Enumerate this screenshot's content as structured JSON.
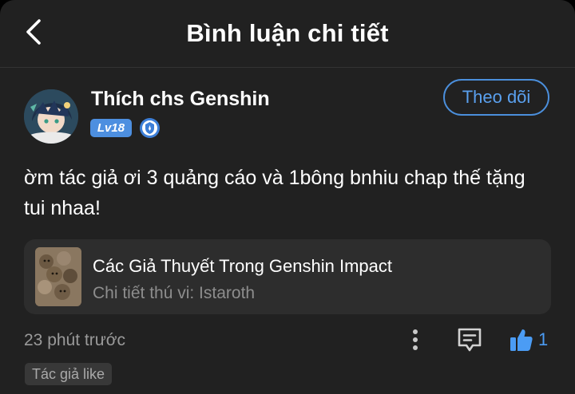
{
  "header": {
    "title": "Bình luận chi tiết",
    "back_icon": "chevron-left-icon"
  },
  "comment": {
    "username": "Thích chs Genshin",
    "level": "Lv18",
    "verified_icon": "shield-badge-icon",
    "follow_label": "Theo dõi",
    "text": "ờm tác giả ơi 3 quảng cáo và 1bông bnhiu chap thế tặng tui nhaa!",
    "timestamp": "23 phút trước",
    "like_count": "1",
    "author_like_tag": "Tác giả like"
  },
  "reference": {
    "title": "Các Giả Thuyết Trong Genshin Impact",
    "subtitle": "Chi tiết thú vi: Istaroth"
  },
  "colors": {
    "background": "#212121",
    "card": "#2d2d2d",
    "accent": "#4b8fdc",
    "like": "#4b9cf4",
    "muted_text": "#9a9a9a"
  }
}
